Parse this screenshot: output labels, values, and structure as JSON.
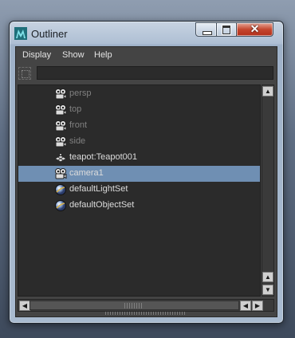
{
  "window": {
    "title": "Outliner"
  },
  "menu": {
    "display": "Display",
    "show": "Show",
    "help": "Help"
  },
  "filter": {
    "value": ""
  },
  "outliner": {
    "items": [
      {
        "label": "persp",
        "icon": "camera-icon",
        "dim": true
      },
      {
        "label": "top",
        "icon": "camera-icon",
        "dim": true
      },
      {
        "label": "front",
        "icon": "camera-icon",
        "dim": true
      },
      {
        "label": "side",
        "icon": "camera-icon",
        "dim": true
      },
      {
        "label": "teapot:Teapot001",
        "icon": "mesh-icon",
        "dim": false
      },
      {
        "label": "camera1",
        "icon": "camera-icon",
        "dim": false,
        "selected": true
      },
      {
        "label": "defaultLightSet",
        "icon": "set-icon",
        "dim": false
      },
      {
        "label": "defaultObjectSet",
        "icon": "set-icon",
        "dim": false
      }
    ]
  },
  "colors": {
    "selection": "#6f8fb3",
    "panel": "#444444",
    "list_bg": "#2b2b2b"
  }
}
